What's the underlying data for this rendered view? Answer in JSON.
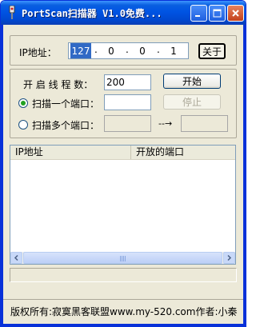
{
  "window": {
    "title": "PortScan扫描器 V1.0免费...",
    "icon": "scanner-app-icon",
    "controls": [
      "minimize-icon",
      "maximize-icon",
      "close-icon"
    ]
  },
  "ip_group": {
    "label": "IP地址：",
    "octets": [
      "127",
      "0",
      "0",
      "1"
    ],
    "about_label": "关于"
  },
  "scan_group": {
    "threads_label": "开 启 线 程 数：",
    "threads_value": "200",
    "start_label": "开始",
    "stop_label": "停止",
    "single_port_label": "扫描一个端口：",
    "multi_port_label": "扫描多个端口：",
    "single_selected": true,
    "single_port_value": "",
    "range_from": "",
    "range_to": "",
    "range_arrow": "--→"
  },
  "results": {
    "columns": [
      "IP地址",
      "开放的端口"
    ],
    "rows": []
  },
  "progress": {
    "value": 0
  },
  "status": {
    "text": "版权所有:寂寞黑客联盟www.my-520.com作者:小秦"
  },
  "colors": {
    "titlebar": "#0054e3",
    "window_bg": "#ece9d8",
    "radio_dot": "#21a121",
    "selected_ip": "#316ac5"
  }
}
